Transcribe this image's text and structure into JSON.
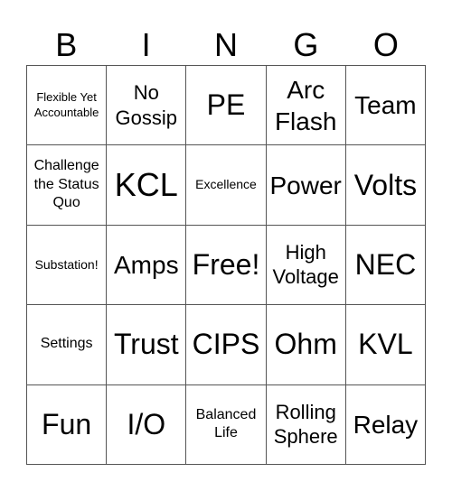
{
  "header": [
    "B",
    "I",
    "N",
    "G",
    "O"
  ],
  "cells": [
    [
      "Flexible Yet Accountable",
      "No Gossip",
      "PE",
      "Arc Flash",
      "Team"
    ],
    [
      "Challenge the Status Quo",
      "KCL",
      "Excellence",
      "Power",
      "Volts"
    ],
    [
      "Substation!",
      "Amps",
      "Free!",
      "High Voltage",
      "NEC"
    ],
    [
      "Settings",
      "Trust",
      "CIPS",
      "Ohm",
      "KVL"
    ],
    [
      "Fun",
      "I/O",
      "Balanced Life",
      "Rolling Sphere",
      "Relay"
    ]
  ]
}
